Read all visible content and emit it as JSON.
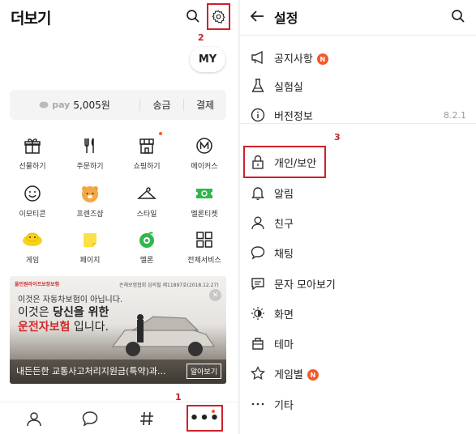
{
  "left": {
    "title": "더보기",
    "my_label": "MY",
    "pay": {
      "logo": "pay",
      "amount": "5,005원",
      "send": "송금",
      "payment": "결제"
    },
    "grid": [
      {
        "label": "선물하기",
        "icon": "gift-icon"
      },
      {
        "label": "주문하기",
        "icon": "fork-knife-icon"
      },
      {
        "label": "쇼핑하기",
        "icon": "store-icon"
      },
      {
        "label": "메이커스",
        "icon": "makers-icon"
      },
      {
        "label": "이모티콘",
        "icon": "emoticon-icon"
      },
      {
        "label": "프렌즈샵",
        "icon": "friends-shop-icon"
      },
      {
        "label": "스타일",
        "icon": "hanger-icon"
      },
      {
        "label": "멜론티켓",
        "icon": "ticket-icon"
      },
      {
        "label": "게임",
        "icon": "game-icon"
      },
      {
        "label": "페이지",
        "icon": "page-icon"
      },
      {
        "label": "멜론",
        "icon": "melon-icon"
      },
      {
        "label": "전체서비스",
        "icon": "all-services-icon"
      }
    ],
    "ad": {
      "brand": "올인원라이프보장보험",
      "top_note": "손해보험협회 심의필 제11897호(2018.12.27)",
      "line1": "이것은 자동차보험이 아닙니다.",
      "line2_pre": "이것은 ",
      "line2_bold": "당신을 위한",
      "line3_red": "운전자보험",
      "line3_post": " 입니다.",
      "caption": "내든든한 교통사고처리지원금(특약)과...",
      "more": "알아보기"
    },
    "more_button": "•••"
  },
  "annotations": {
    "one": "1",
    "two": "2",
    "three": "3"
  },
  "right": {
    "title": "설정",
    "items": [
      {
        "label": "공지사항",
        "icon": "megaphone-icon",
        "badge": "N"
      },
      {
        "label": "실험실",
        "icon": "flask-icon"
      },
      {
        "label": "버전정보",
        "icon": "info-icon",
        "value": "8.2.1"
      },
      {
        "label": "개인/보안",
        "icon": "lock-icon"
      },
      {
        "label": "알림",
        "icon": "bell-icon"
      },
      {
        "label": "친구",
        "icon": "person-icon"
      },
      {
        "label": "채팅",
        "icon": "chat-bubble-icon"
      },
      {
        "label": "문자 모아보기",
        "icon": "message-icon"
      },
      {
        "label": "화면",
        "icon": "brightness-icon"
      },
      {
        "label": "테마",
        "icon": "theme-icon"
      },
      {
        "label": "게임별",
        "icon": "star-icon",
        "badge": "N"
      },
      {
        "label": "기타",
        "icon": "dots-icon"
      }
    ]
  },
  "colors": {
    "accent_red": "#d0202a",
    "badge_orange": "#f25a2a"
  }
}
